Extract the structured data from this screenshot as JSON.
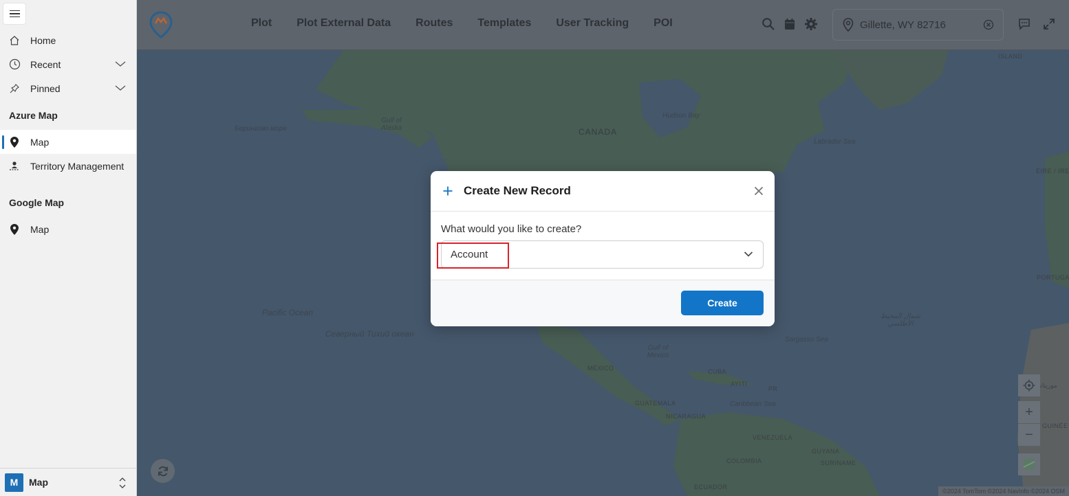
{
  "sidebar": {
    "menu_label": "menu",
    "items": {
      "home": "Home",
      "recent": "Recent",
      "pinned": "Pinned"
    },
    "sections": {
      "azure": {
        "title": "Azure Map",
        "items": [
          "Map",
          "Territory Management"
        ]
      },
      "google": {
        "title": "Google Map",
        "items": [
          "Map"
        ]
      }
    },
    "app_switcher": {
      "badge": "M",
      "name": "Map"
    }
  },
  "topbar": {
    "nav": [
      "Plot",
      "Plot External Data",
      "Routes",
      "Templates",
      "User Tracking",
      "POI"
    ],
    "location_value": "Gillette, WY 82716",
    "icons": [
      "search-icon",
      "calendar-icon",
      "gear-icon",
      "chat-icon",
      "expand-icon"
    ]
  },
  "map": {
    "labels": {
      "island": "ISLAND",
      "hudson_bay": "Hudson Bay",
      "bering_sea": "Берингово море",
      "gulf_alaska": "Gulf of Alaska",
      "canada": "CANADA",
      "labrador_sea": "Labrador Sea",
      "eire": "ÉIRE / IREL",
      "portugal": "PORTUGA",
      "pacific": "Pacific Ocean",
      "pacific_ru": "Северный Тихий океан",
      "atlantic_ar": "شمال المحيط الأطلسي",
      "sargasso": "Sargasso Sea",
      "gulf_mexico": "Gulf of Mexico",
      "mexico": "MÉXICO",
      "cuba": "CUBA",
      "haiti": "AYITI",
      "pr": "PR",
      "caribbean": "Caribbean Sea",
      "guatemala": "GUATEMALA",
      "nicaragua": "NICARAGUA",
      "venezuela": "VENEZUELA",
      "guyana": "GUYANA",
      "suriname": "SURINAME",
      "colombia": "COLOMBIA",
      "ecuador": "ECUADOR",
      "mauritania": "موريتانيا",
      "guinee": "GUINÉE"
    },
    "attribution": "©2024 TomTom ©2024 NavInfo ©2024 OSM",
    "zoom_in": "+",
    "zoom_out": "−"
  },
  "modal": {
    "title": "Create New Record",
    "question": "What would you like to create?",
    "selected": "Account",
    "create_label": "Create"
  },
  "colors": {
    "accent": "#1375c7",
    "highlight": "#d7232b",
    "sidebar_active_bar": "#1f6fb5"
  }
}
